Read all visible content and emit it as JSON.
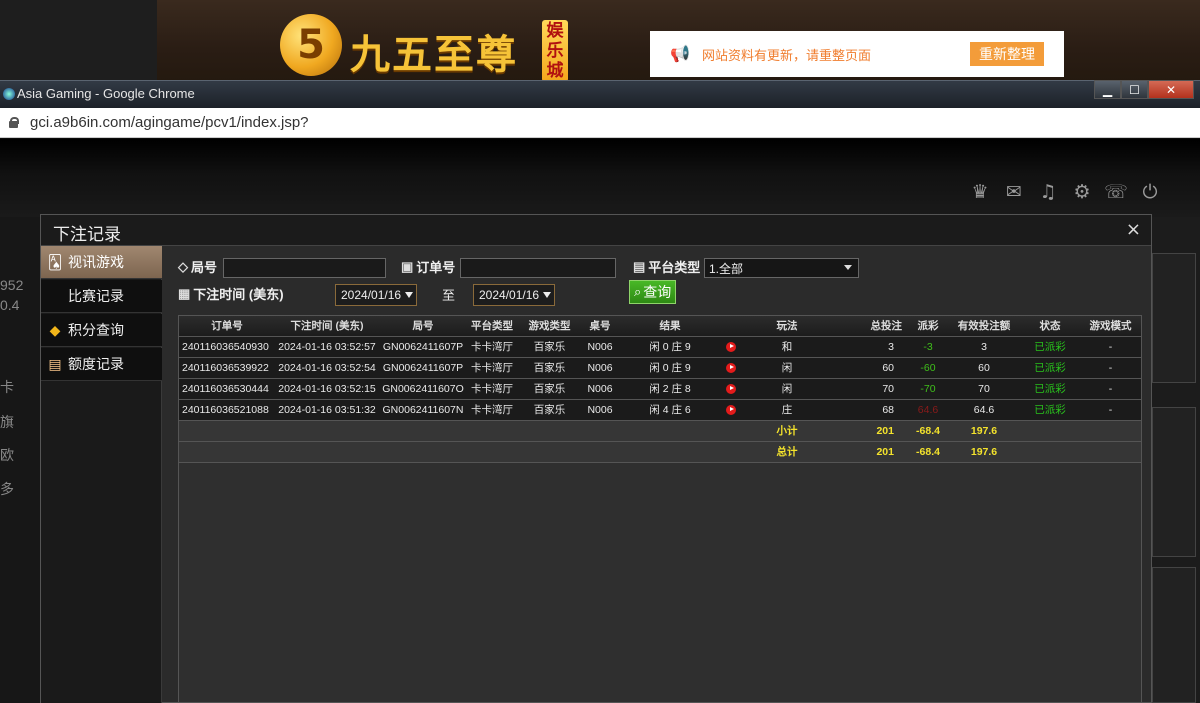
{
  "banner": {
    "logo_mark": "5",
    "logo_text": "九五至尊",
    "logo_tag": [
      "娱",
      "乐",
      "城"
    ],
    "notice_text": "网站资料有更新，请重整页面",
    "notice_button": "重新整理"
  },
  "window": {
    "title": "Asia Gaming - Google Chrome",
    "url": "gci.a9b6in.com/agingame/pcv1/index.jsp?",
    "close_glyph": "✕",
    "max_glyph": "☐",
    "min_glyph": "▁"
  },
  "toolbar_icons": [
    "vip-icon",
    "chat-icon",
    "music-icon",
    "gear-icon",
    "message-icon",
    "power-icon"
  ],
  "background_left": [
    "952",
    "0.4",
    "卡",
    "旗",
    "欧",
    "多"
  ],
  "modal": {
    "title": "下注记录",
    "close": "×"
  },
  "sidebar": {
    "items": [
      {
        "label": "视讯游戏",
        "icon": "cards-icon",
        "active": true
      },
      {
        "label": "比赛记录",
        "icon": "",
        "active": false
      },
      {
        "label": "积分查询",
        "icon": "diamond-icon",
        "active": false
      },
      {
        "label": "额度记录",
        "icon": "document-icon",
        "active": false
      }
    ]
  },
  "filters": {
    "round_label": "局号",
    "round_value": "",
    "order_label": "订单号",
    "order_value": "",
    "platform_label": "平台类型",
    "platform_value": "1.全部",
    "time_label": "下注时间 (美东)",
    "date_from": "2024/01/16",
    "to_label": "至",
    "date_to": "2024/01/16",
    "query_button": "查询"
  },
  "table": {
    "headers": [
      "订单号",
      "下注时间 (美东)",
      "局号",
      "平台类型",
      "游戏类型",
      "桌号",
      "结果",
      "",
      "玩法",
      "总投注",
      "派彩",
      "有效投注额",
      "状态",
      "游戏模式"
    ],
    "rows": [
      {
        "order": "240116036540930",
        "time": "2024-01-16 03:52:57",
        "round": "GN0062411607P",
        "platform": "卡卡湾厅",
        "game": "百家乐",
        "table": "N006",
        "result": "闲 0 庄 9",
        "play": "和",
        "bet": "3",
        "payout": "-3",
        "valid": "3",
        "status": "已派彩",
        "mode": "-"
      },
      {
        "order": "240116036539922",
        "time": "2024-01-16 03:52:54",
        "round": "GN0062411607P",
        "platform": "卡卡湾厅",
        "game": "百家乐",
        "table": "N006",
        "result": "闲 0 庄 9",
        "play": "闲",
        "bet": "60",
        "payout": "-60",
        "valid": "60",
        "status": "已派彩",
        "mode": "-"
      },
      {
        "order": "240116036530444",
        "time": "2024-01-16 03:52:15",
        "round": "GN0062411607O",
        "platform": "卡卡湾厅",
        "game": "百家乐",
        "table": "N006",
        "result": "闲 2 庄 8",
        "play": "闲",
        "bet": "70",
        "payout": "-70",
        "valid": "70",
        "status": "已派彩",
        "mode": "-"
      },
      {
        "order": "240116036521088",
        "time": "2024-01-16 03:51:32",
        "round": "GN0062411607N",
        "platform": "卡卡湾厅",
        "game": "百家乐",
        "table": "N006",
        "result": "闲 4 庄 6",
        "play": "庄",
        "bet": "68",
        "payout": "64.6",
        "valid": "64.6",
        "status": "已派彩",
        "mode": "-"
      }
    ],
    "subtotal": {
      "label": "小计",
      "bet": "201",
      "payout": "-68.4",
      "valid": "197.6"
    },
    "total": {
      "label": "总计",
      "bet": "201",
      "payout": "-68.4",
      "valid": "197.6"
    }
  }
}
